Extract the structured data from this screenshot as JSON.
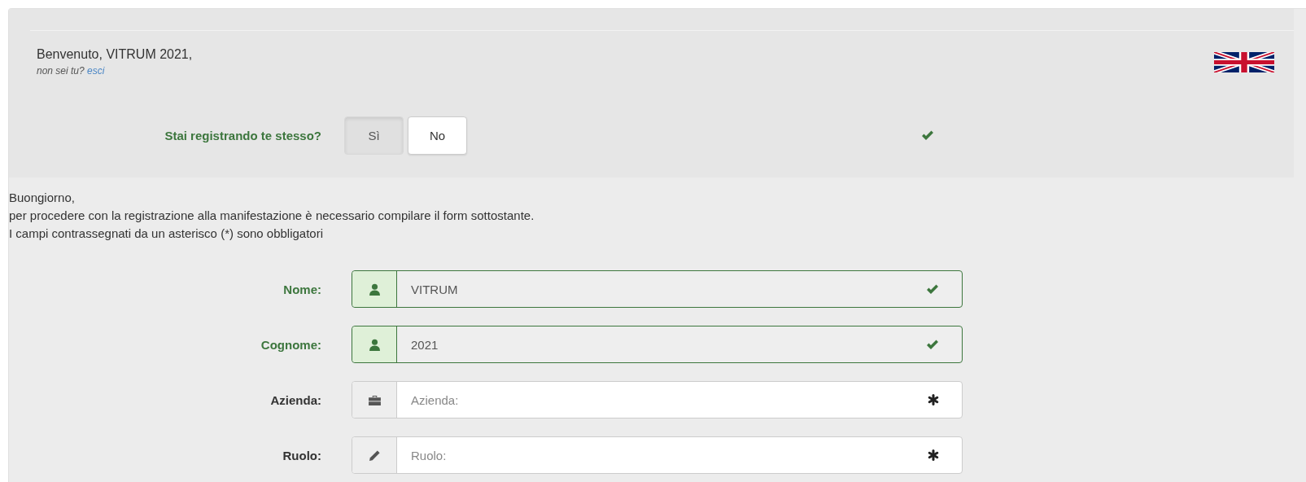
{
  "welcome": {
    "greeting": "Benvenuto, VITRUM 2021,",
    "prompt": "non sei tu?",
    "logout_link": "esci"
  },
  "self_registration": {
    "label": "Stai registrando te stesso?",
    "valid": true,
    "options": [
      {
        "label": "Sì",
        "selected": true
      },
      {
        "label": "No",
        "selected": false
      }
    ]
  },
  "intro": [
    "Buongiorno,",
    "per procedere con la registrazione alla manifestazione è necessario compilare il form sottostante.",
    "I campi contrassegnati da un asterisco (*) sono obbligatori"
  ],
  "fields": [
    {
      "label": "Nome:",
      "kind": "user",
      "value": "VITRUM",
      "valid": true
    },
    {
      "label": "Cognome:",
      "kind": "user",
      "value": "2021",
      "valid": true
    },
    {
      "label": "Azienda:",
      "kind": "briefcase",
      "placeholder": "Azienda:",
      "valid": false
    },
    {
      "label": "Ruolo:",
      "kind": "pencil",
      "placeholder": "Ruolo:",
      "valid": false
    }
  ]
}
